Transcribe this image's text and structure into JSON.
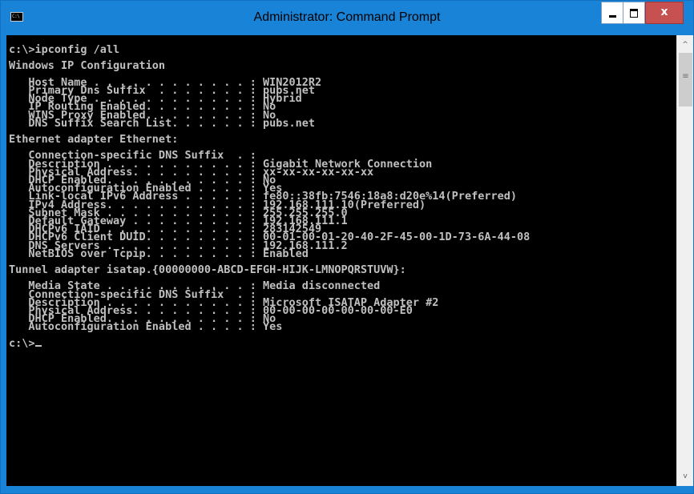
{
  "window": {
    "title": "Administrator: Command Prompt",
    "icon": "cmd-icon",
    "icon_label": "C:\\",
    "close_label": "x"
  },
  "console": {
    "lines": [
      "c:\\>ipconfig /all",
      "",
      "Windows IP Configuration",
      "",
      "   Host Name . . . . . . . . . . . . : WIN2012R2",
      "   Primary Dns Suffix  . . . . . . . : pubs.net",
      "   Node Type . . . . . . . . . . . . : Hybrid",
      "   IP Routing Enabled. . . . . . . . : No",
      "   WINS Proxy Enabled. . . . . . . . : No",
      "   DNS Suffix Search List. . . . . . : pubs.net",
      "",
      "Ethernet adapter Ethernet:",
      "",
      "   Connection-specific DNS Suffix  . :",
      "   Description . . . . . . . . . . . : Gigabit Network Connection",
      "   Physical Address. . . . . . . . . : xx-xx-xx-xx-xx-xx",
      "   DHCP Enabled. . . . . . . . . . . : No",
      "   Autoconfiguration Enabled . . . . : Yes",
      "   Link-local IPv6 Address . . . . . : fe80::38fb:7546:18a8:d20e%14(Preferred)",
      "   IPv4 Address. . . . . . . . . . . : 192.168.111.10(Preferred)",
      "   Subnet Mask . . . . . . . . . . . : 255.255.255.0",
      "   Default Gateway . . . . . . . . . : 192.168.111.1",
      "   DHCPv6 IAID . . . . . . . . . . . : 283142549",
      "   DHCPv6 Client DUID. . . . . . . . : 00-01-00-01-20-40-2F-45-00-1D-73-6A-44-08",
      "   DNS Servers . . . . . . . . . . . : 192.168.111.2",
      "   NetBIOS over Tcpip. . . . . . . . : Enabled",
      "",
      "Tunnel adapter isatap.{00000000-ABCD-EFGH-HIJK-LMNOPQRSTUVW}:",
      "",
      "   Media State . . . . . . . . . . . : Media disconnected",
      "   Connection-specific DNS Suffix  . :",
      "   Description . . . . . . . . . . . : Microsoft ISATAP Adapter #2",
      "   Physical Address. . . . . . . . . : 00-00-00-00-00-00-00-E0",
      "   DHCP Enabled. . . . . . . . . . . : No",
      "   Autoconfiguration Enabled . . . . : Yes",
      ""
    ],
    "prompt": "c:\\>"
  },
  "colors": {
    "titlebar": "#1883d7",
    "console_bg": "#000000",
    "console_fg": "#c0c0c0",
    "close_button": "#c75050"
  }
}
